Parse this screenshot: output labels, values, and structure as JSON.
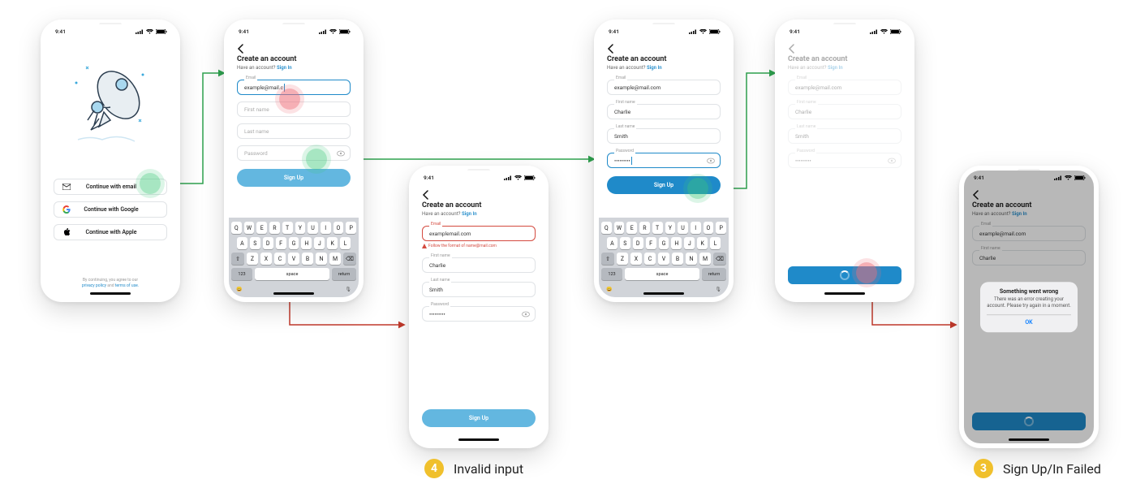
{
  "status_time": "9:41",
  "landing": {
    "continue_email": "Continue with email",
    "continue_google": "Continue with Google",
    "continue_apple": "Continue with Apple",
    "legal_prefix": "By continuing, you agree to our",
    "privacy": "privacy policy",
    "and": "and",
    "terms": "terms of use."
  },
  "create": {
    "title": "Create an account",
    "have": "Have an account?",
    "signin": "Sign In",
    "email_label": "Email",
    "firstname_label": "First name",
    "lastname_label": "Last name",
    "password_label": "Password",
    "email_partial": "example@mail.c",
    "email_full": "example@mail.com",
    "email_invalid": "examplemail.com",
    "invalid_msg": "Follow the format of name@mail.com",
    "firstname_val": "Charlie",
    "lastname_val": "Smith",
    "password_val": "•••••••••",
    "signup": "Sign Up"
  },
  "keyboard": {
    "rows": [
      [
        "Q",
        "W",
        "E",
        "R",
        "T",
        "Y",
        "U",
        "I",
        "O",
        "P"
      ],
      [
        "A",
        "S",
        "D",
        "F",
        "G",
        "H",
        "J",
        "K",
        "L"
      ],
      [
        "Z",
        "X",
        "C",
        "V",
        "B",
        "N",
        "M"
      ]
    ],
    "shift": "⇧",
    "del": "⌫",
    "num": "123",
    "space": "space",
    "ret": "return",
    "emoji": "😀",
    "mic": "🎙"
  },
  "error_modal": {
    "title": "Something went wrong",
    "msg": "There was an error creating your account. Please try again in a moment.",
    "ok": "OK"
  },
  "callouts": {
    "invalid": "Invalid input",
    "failed": "Sign Up/In Failed"
  }
}
